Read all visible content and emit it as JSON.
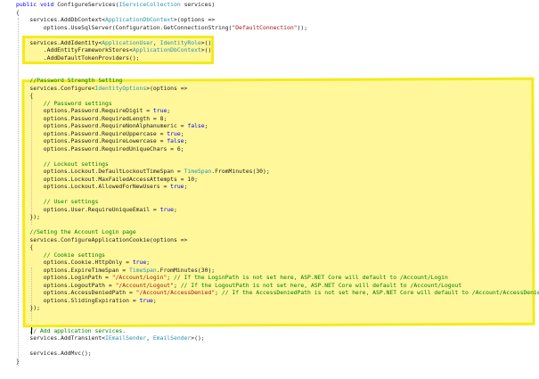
{
  "editor": {
    "colors": {
      "keyword": "#0000ff",
      "type": "#2b91af",
      "string": "#a31515",
      "comment": "#008000",
      "text": "#202020",
      "highlight_fill": "#fff79a",
      "highlight_stroke": "#f3ea1d"
    },
    "lines": [
      [
        {
          "t": "public",
          "c": "keyword"
        },
        {
          "t": " "
        },
        {
          "t": "void",
          "c": "keyword"
        },
        {
          "t": " ConfigureServices("
        },
        {
          "t": "IServiceCollection",
          "c": "type"
        },
        {
          "t": " services)"
        }
      ],
      [
        {
          "t": "{"
        }
      ],
      [
        {
          "t": "    services.AddDbContext<"
        },
        {
          "t": "ApplicationDbContext",
          "c": "type"
        },
        {
          "t": ">(options =>"
        }
      ],
      [
        {
          "t": "        options.UseSqlServer(Configuration.GetConnectionString("
        },
        {
          "t": "\"DefaultConnection\"",
          "c": "string"
        },
        {
          "t": "));"
        }
      ],
      [
        {
          "t": ""
        }
      ],
      [
        {
          "t": "    services.AddIdentity<"
        },
        {
          "t": "ApplicationUser",
          "c": "type"
        },
        {
          "t": ", "
        },
        {
          "t": "IdentityRole",
          "c": "type"
        },
        {
          "t": ">()"
        }
      ],
      [
        {
          "t": "        .AddEntityFrameworkStores<"
        },
        {
          "t": "ApplicationDbContext",
          "c": "type"
        },
        {
          "t": ">()"
        }
      ],
      [
        {
          "t": "        .AddDefaultTokenProviders();"
        }
      ],
      [
        {
          "t": ""
        }
      ],
      [
        {
          "t": ""
        }
      ],
      [
        {
          "t": "    //Password Strength Setting",
          "c": "comment"
        }
      ],
      [
        {
          "t": "    services.Configure<"
        },
        {
          "t": "IdentityOptions",
          "c": "type"
        },
        {
          "t": ">(options =>"
        }
      ],
      [
        {
          "t": "    {"
        }
      ],
      [
        {
          "t": "        // Password settings",
          "c": "comment"
        }
      ],
      [
        {
          "t": "        options.Password.RequireDigit = "
        },
        {
          "t": "true",
          "c": "keyword"
        },
        {
          "t": ";"
        }
      ],
      [
        {
          "t": "        options.Password.RequiredLength = 8;"
        }
      ],
      [
        {
          "t": "        options.Password.RequireNonAlphanumeric = "
        },
        {
          "t": "false",
          "c": "keyword"
        },
        {
          "t": ";"
        }
      ],
      [
        {
          "t": "        options.Password.RequireUppercase = "
        },
        {
          "t": "true",
          "c": "keyword"
        },
        {
          "t": ";"
        }
      ],
      [
        {
          "t": "        options.Password.RequireLowercase = "
        },
        {
          "t": "false",
          "c": "keyword"
        },
        {
          "t": ";"
        }
      ],
      [
        {
          "t": "        options.Password.RequiredUniqueChars = 6;"
        }
      ],
      [
        {
          "t": ""
        }
      ],
      [
        {
          "t": "        // Lockout settings",
          "c": "comment"
        }
      ],
      [
        {
          "t": "        options.Lockout.DefaultLockoutTimeSpan = "
        },
        {
          "t": "TimeSpan",
          "c": "type"
        },
        {
          "t": ".FromMinutes(30);"
        }
      ],
      [
        {
          "t": "        options.Lockout.MaxFailedAccessAttempts = 10;"
        }
      ],
      [
        {
          "t": "        options.Lockout.AllowedForNewUsers = "
        },
        {
          "t": "true",
          "c": "keyword"
        },
        {
          "t": ";"
        }
      ],
      [
        {
          "t": ""
        }
      ],
      [
        {
          "t": "        // User settings",
          "c": "comment"
        }
      ],
      [
        {
          "t": "        options.User.RequireUniqueEmail = "
        },
        {
          "t": "true",
          "c": "keyword"
        },
        {
          "t": ";"
        }
      ],
      [
        {
          "t": "    });"
        }
      ],
      [
        {
          "t": ""
        }
      ],
      [
        {
          "t": "    //Seting the Account Login page",
          "c": "comment"
        }
      ],
      [
        {
          "t": "    services.ConfigureApplicationCookie(options =>"
        }
      ],
      [
        {
          "t": "    {"
        }
      ],
      [
        {
          "t": "        // Cookie settings",
          "c": "comment"
        }
      ],
      [
        {
          "t": "        options.Cookie.HttpOnly = "
        },
        {
          "t": "true",
          "c": "keyword"
        },
        {
          "t": ";"
        }
      ],
      [
        {
          "t": "        options.ExpireTimeSpan = "
        },
        {
          "t": "TimeSpan",
          "c": "type"
        },
        {
          "t": ".FromMinutes(30);"
        }
      ],
      [
        {
          "t": "        options.LoginPath = "
        },
        {
          "t": "\"/Account/Login\"",
          "c": "string"
        },
        {
          "t": "; "
        },
        {
          "t": "// If the LoginPath is not set here, ASP.NET Core will default to /Account/Login",
          "c": "comment"
        }
      ],
      [
        {
          "t": "        options.LogoutPath = "
        },
        {
          "t": "\"/Account/Logout\"",
          "c": "string"
        },
        {
          "t": "; "
        },
        {
          "t": "// If the LogoutPath is not set here, ASP.NET Core will default to /Account/Logout",
          "c": "comment"
        }
      ],
      [
        {
          "t": "        options.AccessDeniedPath = "
        },
        {
          "t": "\"/Account/AccessDenied\"",
          "c": "string"
        },
        {
          "t": "; "
        },
        {
          "t": "// If the AccessDeniedPath is not set here, ASP.NET Core will default to /Account/AccessDenied",
          "c": "comment"
        }
      ],
      [
        {
          "t": "        options.SlidingExpiration = "
        },
        {
          "t": "true",
          "c": "keyword"
        },
        {
          "t": ";"
        }
      ],
      [
        {
          "t": "    });"
        }
      ],
      [
        {
          "t": ""
        }
      ],
      [
        {
          "t": ""
        }
      ],
      [
        {
          "t": "    // Add application services.",
          "c": "comment"
        }
      ],
      [
        {
          "t": "    services.AddTransient<"
        },
        {
          "t": "IEmailSender",
          "c": "type"
        },
        {
          "t": ", "
        },
        {
          "t": "EmailSender",
          "c": "type"
        },
        {
          "t": ">();"
        }
      ],
      [
        {
          "t": ""
        }
      ],
      [
        {
          "t": "    services.AddMvc();"
        }
      ],
      [
        {
          "t": "}"
        }
      ]
    ]
  }
}
